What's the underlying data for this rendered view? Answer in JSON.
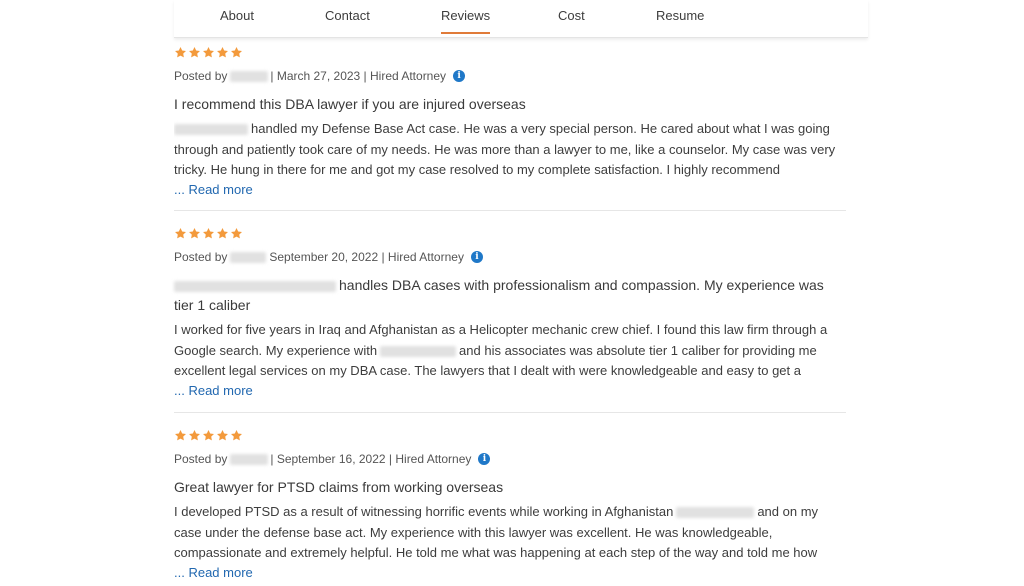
{
  "tabs": [
    {
      "label": "About"
    },
    {
      "label": "Contact"
    },
    {
      "label": "Reviews",
      "active": true
    },
    {
      "label": "Cost"
    },
    {
      "label": "Resume"
    }
  ],
  "colors": {
    "accent": "#e07b39",
    "star": "#f39a3c",
    "link": "#2268b0",
    "info": "#1f78c8"
  },
  "reviews": [
    {
      "rating": 5,
      "posted_prefix": "Posted by",
      "meta": "| March 27, 2023 | Hired Attorney",
      "title": "I recommend this DBA lawyer if you are injured overseas",
      "body_1": "handled my Defense Base Act case. He was a very special person. He cared about what I was going through and patiently took care of my needs. He was more than a lawyer to me, like a counselor. My case was very tricky. He hung in there for me and got my case resolved to my complete satisfaction. I highly recommend",
      "read_more": "... Read more"
    },
    {
      "rating": 5,
      "posted_prefix": "Posted by",
      "meta": "September 20, 2022 | Hired Attorney",
      "title": "handles DBA cases with professionalism and compassion. My experience was tier 1 caliber",
      "body_1": "I worked for five years in Iraq and Afghanistan as a Helicopter mechanic crew chief. I found this law firm through a Google search. My experience with",
      "body_2": "and his associates was absolute tier 1 caliber for providing me excellent legal services on my DBA case. The lawyers that I dealt with were knowledgeable and easy to get a",
      "read_more": "... Read more"
    },
    {
      "rating": 5,
      "posted_prefix": "Posted by",
      "meta": "| September 16, 2022 | Hired Attorney",
      "title": "Great lawyer for PTSD claims from working overseas",
      "body_1": "I developed PTSD as a result of witnessing horrific events while working in Afghanistan",
      "body_2": "and on my case under the defense base act. My experience with this lawyer was excellent. He was knowledgeable, compassionate and extremely helpful. He told me what was happening at each step of the way and told me how",
      "read_more": "... Read more"
    }
  ]
}
